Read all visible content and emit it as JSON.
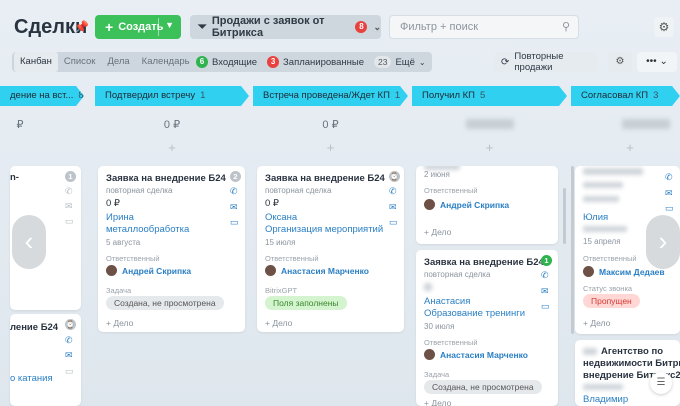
{
  "header": {
    "title": "Сделки",
    "pin_icon": "pin-icon",
    "create_label": "Создать",
    "funnel_label": "Продажи с заявок от Битрикса",
    "funnel_badge": "8",
    "filter_placeholder": "Фильтр + поиск",
    "gear_icon": "gear-icon"
  },
  "views": [
    "Канбан",
    "Список",
    "Дела",
    "Календарь"
  ],
  "counters": {
    "incoming_count": "6",
    "incoming_label": "Входящие",
    "planned_count": "3",
    "planned_label": "Запланированные",
    "more_count": "23",
    "more_label": "Ещё"
  },
  "toolbar": {
    "repeat_sales": "Повторные продажи"
  },
  "columns": [
    {
      "title": "дение на вст...",
      "count": "8"
    },
    {
      "title": "Подтвердил встречу",
      "count": "1",
      "sum": "0 ₽"
    },
    {
      "title": "Встреча проведена/Ждет КП",
      "count": "1",
      "sum": "0 ₽"
    },
    {
      "title": "Получил КП",
      "count": "5"
    },
    {
      "title": "Согласовал КП",
      "count": "3"
    }
  ],
  "cards": {
    "col0_top": {
      "title": "n-",
      "badge": "1"
    },
    "col0_bottom": {
      "title": "ление Б24",
      "text": "о катания"
    },
    "col1": {
      "title": "Заявка на внедрение Б24",
      "sub": "повторная сделка",
      "sum": "0 ₽",
      "contact": "Ирина",
      "company": "металлообработка",
      "date": "5 августа",
      "resp_label": "Ответственный",
      "resp_name": "Андрей Скрипка",
      "task_label": "Задача",
      "task_status": "Создана, не просмотрена",
      "add": "+ Дело",
      "badge": "2"
    },
    "col2": {
      "title": "Заявка на внедрение Б24",
      "sub": "повторная сделка",
      "sum": "0 ₽",
      "contact": "Оксана",
      "company": "Организация мероприятий",
      "date": "15 июля",
      "resp_label": "Ответственный",
      "resp_name": "Анастасия Марченко",
      "gpt_label": "BitrixGPT",
      "gpt_status": "Поля заполнены",
      "add": "+ Дело"
    },
    "col3_top": {
      "date": "2 июня",
      "resp_label": "Ответственный",
      "resp_name": "Андрей Скрипка",
      "add": "+ Дело"
    },
    "col3_bottom": {
      "title": "Заявка на внедрение Б24",
      "sub": "повторная сделка",
      "contact": "Анастасия",
      "company": "Образование тренинги",
      "date": "30 июля",
      "resp_label": "Ответственный",
      "resp_name": "Анастасия Марченко",
      "task_label": "Задача",
      "task_status": "Создана, не просмотрена",
      "add": "+ Дело",
      "badge": "1"
    },
    "col4_top": {
      "contact": "Юлия",
      "date": "15 апреля",
      "resp_label": "Ответственный",
      "resp_name": "Максим Дедаев",
      "call_label": "Статус звонка",
      "call_status": "Пропущен",
      "add": "+ Дело"
    },
    "col4_bottom": {
      "title_l1": "Агентство по",
      "title_l2": "недвижимости Битрикс",
      "title_l3": "внедрение Битрикс24",
      "contact": "Владимир Недвижимост"
    }
  }
}
